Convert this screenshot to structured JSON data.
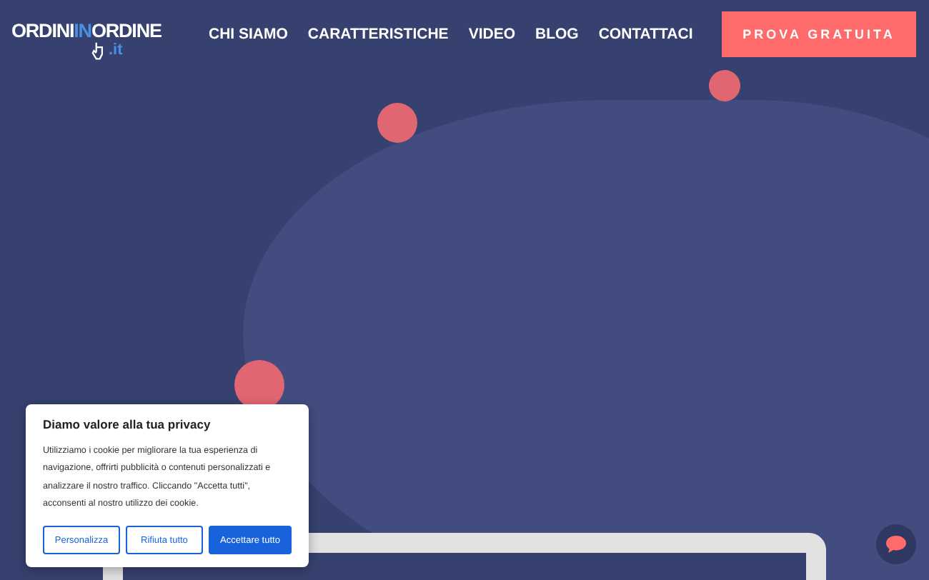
{
  "logo": {
    "part_1": "ORDINI",
    "part_2": "IN",
    "part_3": "ORDINE",
    "suffix": ".it"
  },
  "nav": [
    "CHI SIAMO",
    "CARATTERISTICHE",
    "VIDEO",
    "BLOG",
    "CONTATTACI"
  ],
  "cta_button": "PROVA GRATUITA",
  "cookie_banner": {
    "title": "Diamo valore alla tua privacy",
    "text": "Utilizziamo i cookie per migliorare la tua esperienza di navigazione, offrirti pubblicità o contenuti personalizzati e analizzare il nostro traffico. Cliccando \"Accetta tutti\", acconsenti al nostro utilizzo dei cookie.",
    "buttons": [
      {
        "label": "Personalizza",
        "kind": "outline"
      },
      {
        "label": "Rifiuta tutto",
        "kind": "outline"
      },
      {
        "label": "Accettare tutto",
        "kind": "primary"
      }
    ]
  }
}
